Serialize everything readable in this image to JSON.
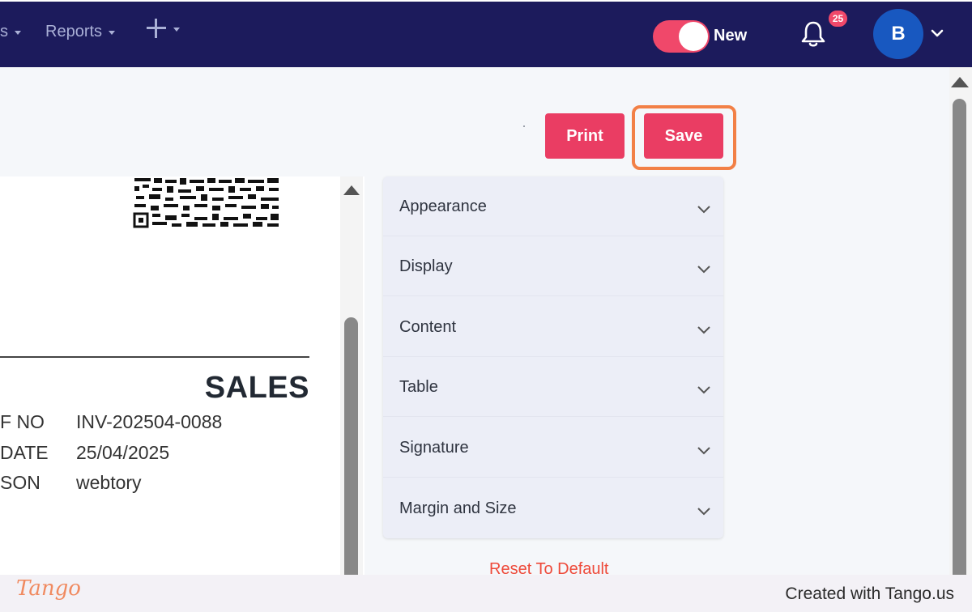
{
  "nav": {
    "prev_item_partial": "s",
    "reports": "Reports",
    "toggle_label": "New",
    "notification_count": "25",
    "avatar_initial": "B"
  },
  "toolbar": {
    "print_label": "Print",
    "save_label": "Save"
  },
  "preview": {
    "title": "SALES",
    "fields": [
      {
        "label": "F NO",
        "value": "INV-202504-0088"
      },
      {
        "label": "DATE",
        "value": "25/04/2025"
      },
      {
        "label": "SON",
        "value": "webtory"
      }
    ]
  },
  "settings": {
    "sections": [
      "Appearance",
      "Display",
      "Content",
      "Table",
      "Signature",
      "Margin and Size"
    ],
    "reset_label": "Reset To Default"
  },
  "footer": {
    "logo": "Tango",
    "credit": "Created with Tango.us"
  },
  "colors": {
    "nav_bg": "#1c1b5c",
    "accent": "#ea3d63",
    "highlight": "#f28046",
    "reset_text": "#ee4a3a"
  }
}
